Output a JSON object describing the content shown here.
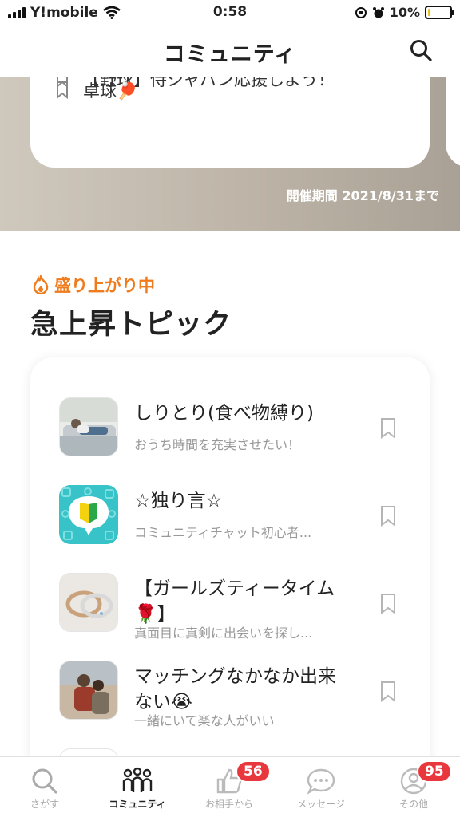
{
  "status_bar": {
    "carrier": "Y!mobile",
    "time": "0:58",
    "battery": "10%",
    "battery_level": 0.1
  },
  "header": {
    "title": "コミュニティ",
    "search_icon": "search-icon"
  },
  "event": {
    "partial_item": "【野球】侍ジャパン応援しよう！",
    "items": [
      {
        "label": "卓球🏓"
      }
    ],
    "period": "開催期間 2021/8/31まで"
  },
  "trending": {
    "subtitle": "盛り上がり中",
    "title": "急上昇トピック",
    "topics": [
      {
        "name": "しりとり(食べ物縛り)",
        "desc": "おうち時間を充実させたい！"
      },
      {
        "name": "☆独り言☆",
        "desc": "コミュニティチャット初心者..."
      },
      {
        "name": "【ガールズティータイム🌹】",
        "desc": "真面目に真剣に出会いを探し..."
      },
      {
        "name": "マッチングなかなか出来ない😭",
        "desc": "一緒にいて楽な人がいい"
      }
    ]
  },
  "tabbar": {
    "tabs": [
      {
        "label": "さがす",
        "icon": "search-icon"
      },
      {
        "label": "コミュニティ",
        "icon": "community-icon"
      },
      {
        "label": "お相手から",
        "icon": "thumbs-up-icon",
        "badge": "56"
      },
      {
        "label": "メッセージ",
        "icon": "chat-bubble-icon"
      },
      {
        "label": "その他",
        "icon": "profile-icon",
        "badge": "95"
      }
    ]
  },
  "colors": {
    "accent_orange": "#f07b1c",
    "badge_red": "#e8383d",
    "battery_yellow": "#e8c021"
  }
}
